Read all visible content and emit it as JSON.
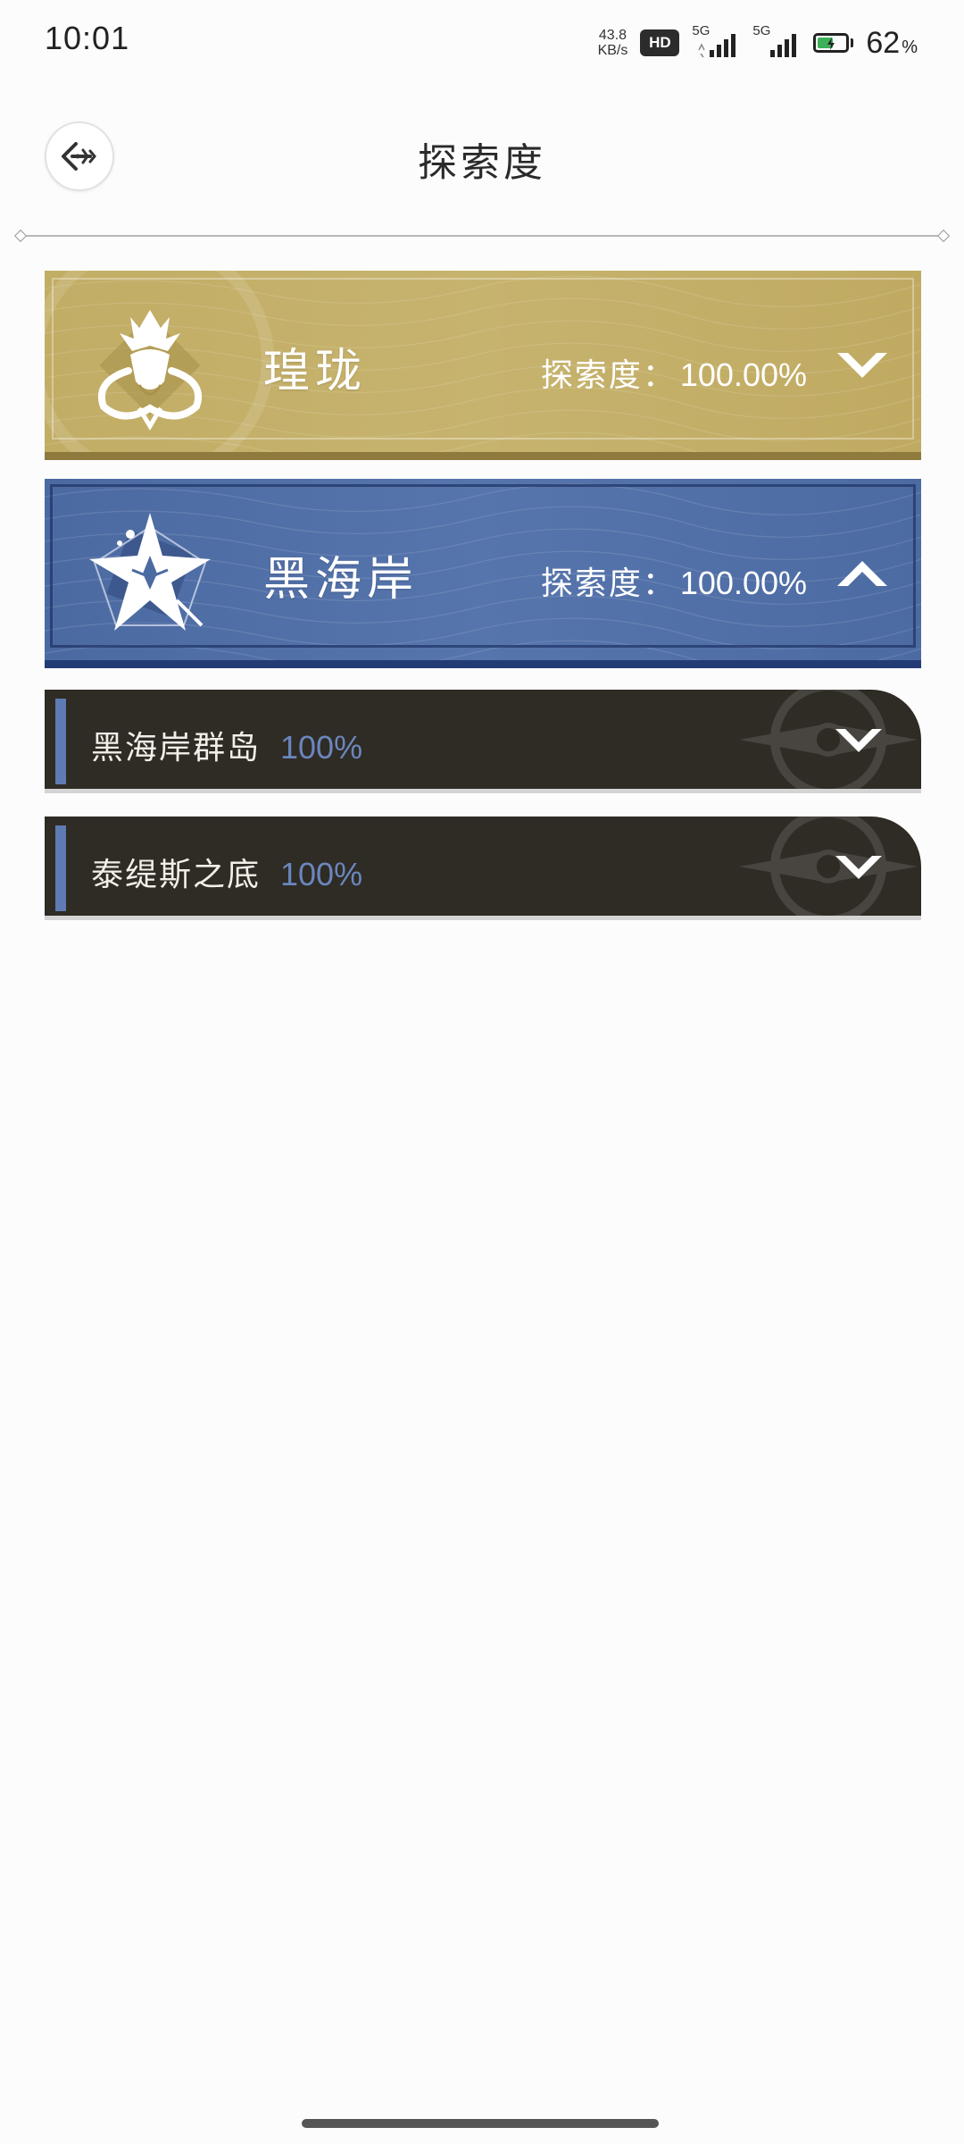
{
  "status_bar": {
    "time": "10:01",
    "net_speed_value": "43.8",
    "net_speed_unit": "KB/s",
    "hd_badge": "HD",
    "signal_1_label": "5G",
    "signal_2_label": "5G",
    "battery_percent": "62",
    "battery_percent_sign": "%",
    "battery_level": 0.62,
    "battery_color": "#3cb15a"
  },
  "header": {
    "back_icon": "back-arrow-icon",
    "title": "探索度"
  },
  "regions": [
    {
      "name": "瑝珑",
      "progress_label": "探索度：",
      "progress_value": "100.00%",
      "emblem_icon": "dragon-emblem-icon",
      "toggle_icon": "chevron-down-icon",
      "expanded": false,
      "color": "#c4b06a"
    },
    {
      "name": "黑海岸",
      "progress_label": "探索度：",
      "progress_value": "100.00%",
      "emblem_icon": "star-flower-emblem-icon",
      "toggle_icon": "chevron-up-icon",
      "expanded": true,
      "color": "#5271a8"
    }
  ],
  "subregions": [
    {
      "name": "黑海岸群岛",
      "percent": "100%",
      "toggle_icon": "chevron-down-icon"
    },
    {
      "name": "泰缇斯之底",
      "percent": "100%",
      "toggle_icon": "chevron-down-icon"
    }
  ]
}
